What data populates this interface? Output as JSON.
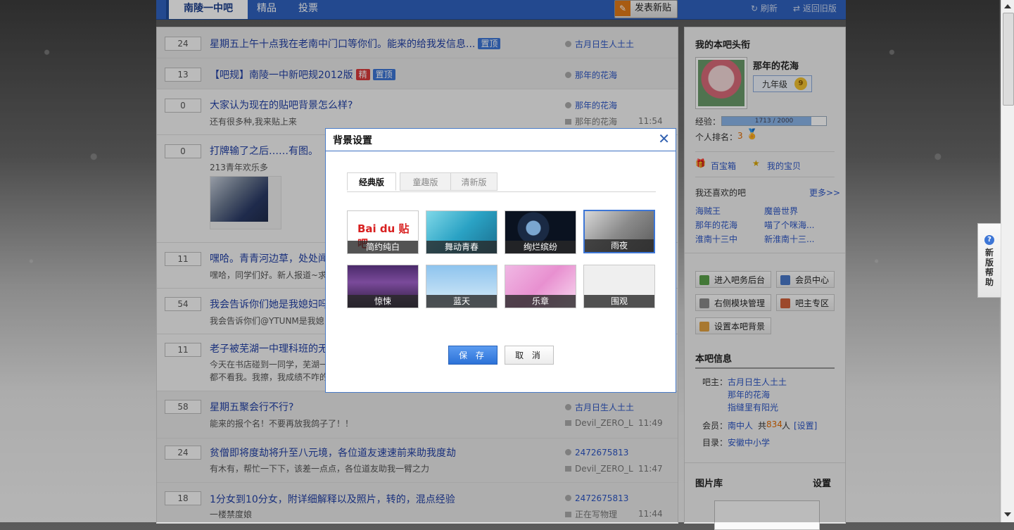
{
  "nav": {
    "forum_tab": "南陵一中吧",
    "tabs": [
      "精品",
      "投票"
    ],
    "post_button": "发表新贴",
    "refresh": "刷新",
    "back_old": "返回旧版"
  },
  "threads": [
    {
      "count": "24",
      "title": "星期五上午十点我在老南中门口等你们。能来的给我发信息...",
      "badges": [
        "置顶"
      ],
      "author": "古月日生人土土",
      "abstract": "",
      "last_reply": "",
      "time": ""
    },
    {
      "count": "13",
      "title": "【吧规】南陵一中新吧规2012版",
      "badges": [
        "精",
        "置顶"
      ],
      "author": "那年的花海",
      "abstract": "",
      "last_reply": "",
      "time": ""
    },
    {
      "count": "0",
      "title": "大家认为现在的贴吧背景怎么样?",
      "badges": [],
      "author": "那年的花海",
      "abstract": "还有很多种,我来贴上来",
      "last_reply": "那年的花海",
      "time": "11:54"
    },
    {
      "count": "0",
      "title": "打牌输了之后……有图。",
      "badges": [],
      "author": "",
      "abstract": "213青年欢乐多",
      "last_reply": "",
      "time": ""
    },
    {
      "count": "11",
      "title": "嘿哈。青青河边草，处处闻",
      "badges": [],
      "author": "",
      "abstract": "嘿哈，同学们好。新人报道~求",
      "last_reply": "",
      "time": ""
    },
    {
      "count": "54",
      "title": "我会告诉你们她是我媳妇吗",
      "badges": [],
      "author": "",
      "abstract": "我会告诉你们@YTUNM是我媳",
      "last_reply": "",
      "time": ""
    },
    {
      "count": "11",
      "title": "老子被芜湖一中理科班的无",
      "badges": [],
      "author": "",
      "abstract": "今天在书店碰到一同学，芜湖一",
      "abstract2": "都不看我。我擦，我成绩不咋的",
      "last_reply": "",
      "time": ""
    },
    {
      "count": "58",
      "title": "星期五聚会行不行?",
      "badges": [],
      "author": "古月日生人土土",
      "abstract": "能来的报个名！不要再放我鸽子了！！",
      "last_reply": "Devil_ZERO_L",
      "time": "11:49"
    },
    {
      "count": "24",
      "title": "贫僧即将度劫将升至八元境，各位道友速速前来助我度劫",
      "badges": [],
      "author": "2472675813",
      "abstract": "有木有，帮忙一下下，该差一点点，各位道友助我一臂之力",
      "last_reply": "Devil_ZERO_L",
      "time": "11:47"
    },
    {
      "count": "18",
      "title": "1分女到10分女，附详细解释以及照片，转的，混点经验",
      "badges": [],
      "author": "2472675813",
      "abstract": "一楼禁度娘",
      "last_reply": "正在写物理",
      "time": "11:44"
    }
  ],
  "sidebar": {
    "my_title_heading": "我的本吧头衔",
    "username": "那年的花海",
    "level": "九年级",
    "level_num": "9",
    "exp_label": "经验：",
    "exp_value": "1713 / 2000",
    "exp_fraction": 0.8565,
    "rank_label": "个人排名：",
    "rank_value": "3",
    "treasure_box": "百宝箱",
    "my_treasure": "我的宝贝",
    "also_like": "我还喜欢的吧",
    "more": "更多>>",
    "liked": [
      "海贼王",
      "魔兽世界",
      "那年的花海",
      "喵了个咪海...",
      "淮南十三中",
      "新淮南十三..."
    ],
    "buttons": [
      "进入吧务后台",
      "会员中心",
      "右侧模块管理",
      "吧主专区",
      "设置本吧背景"
    ],
    "info_heading": "本吧信息",
    "owner_label": "吧主：",
    "owners": [
      "古月日生人土土",
      "那年的花海",
      "指缝里有阳光"
    ],
    "member_label": "会员：",
    "member_name": "南中人",
    "member_total_prefix": "共",
    "member_count": "834",
    "member_suffix": "人",
    "member_set": "[设置]",
    "dir_label": "目录：",
    "dir_value": "安徽中小学",
    "gallery": "图片库",
    "gallery_set": "设置"
  },
  "help": {
    "text": "新版帮助"
  },
  "dialog": {
    "title": "背景设置",
    "tabs": [
      "经典版",
      "童趣版",
      "清新版"
    ],
    "skins": [
      "简约纯白",
      "舞动青春",
      "绚烂缤纷",
      "雨夜",
      "惊悚",
      "蓝天",
      "乐章",
      "围观"
    ],
    "selected": "雨夜",
    "baidu_logo": "Bai du 贴吧",
    "save": "保 存",
    "cancel": "取 消"
  },
  "colors": {
    "accent": "#2f62bf",
    "link": "#2b55c4",
    "badge_top": "#3d76d6",
    "badge_jing": "#d93a3a"
  }
}
